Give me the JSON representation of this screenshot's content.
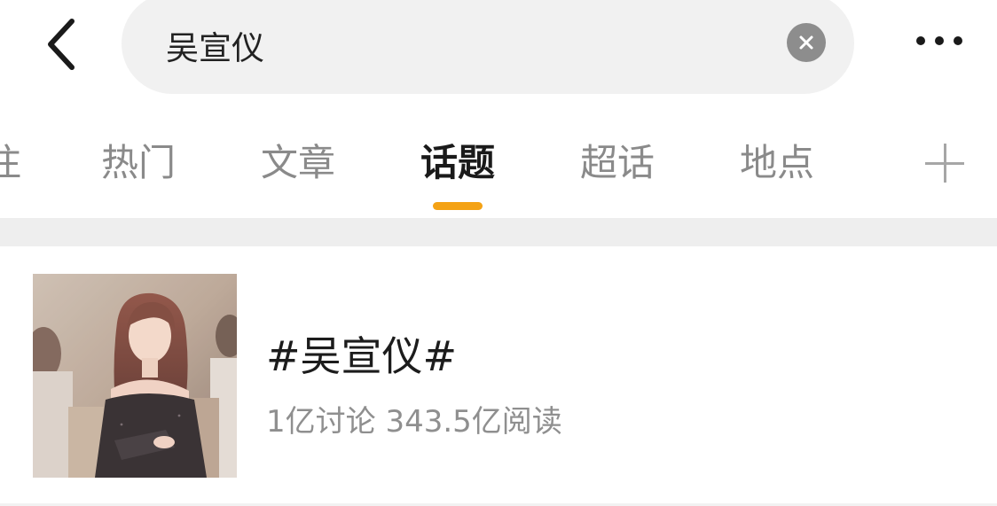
{
  "header": {
    "back_icon": "chevron-left-icon",
    "search_query": "吴宣仪",
    "clear_icon": "clear-icon",
    "more_icon": "more-horizontal-icon"
  },
  "tabs": {
    "items": [
      {
        "label": "注",
        "active": false
      },
      {
        "label": "热门",
        "active": false
      },
      {
        "label": "文章",
        "active": false
      },
      {
        "label": "话题",
        "active": true
      },
      {
        "label": "超话",
        "active": false
      },
      {
        "label": "地点",
        "active": false
      }
    ],
    "add_icon": "plus-icon",
    "accent_color": "#f4a215"
  },
  "topic": {
    "title": "#吴宣仪#",
    "discussions": "1亿讨论",
    "reads": "343.5亿阅读",
    "stats": "1亿讨论 343.5亿阅读"
  }
}
